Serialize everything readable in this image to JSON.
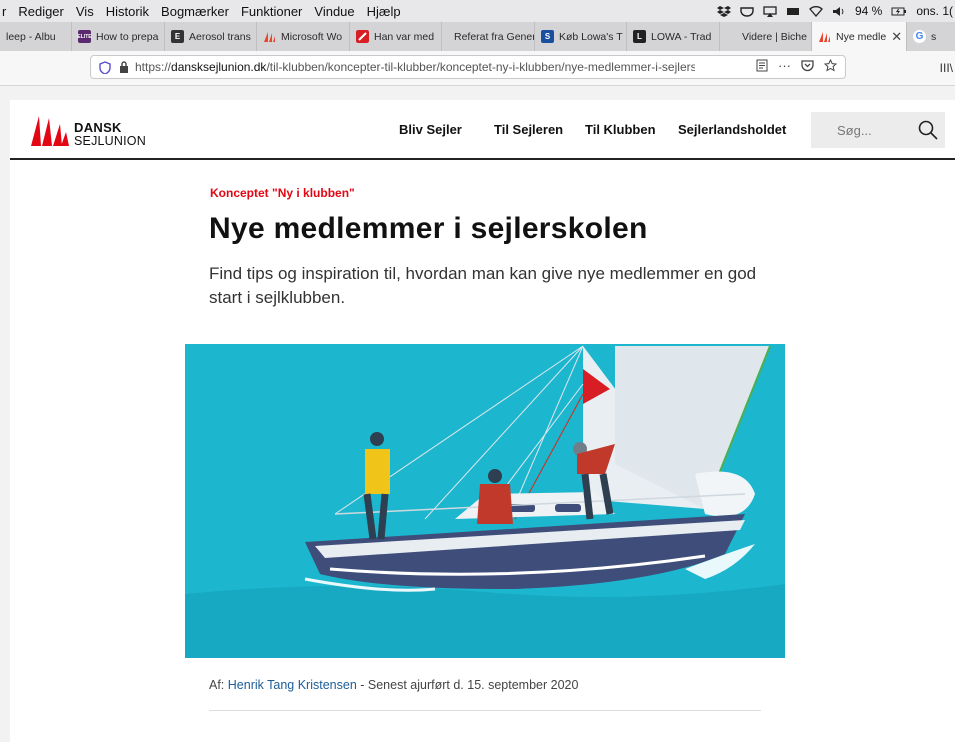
{
  "menubar": {
    "items": [
      "r",
      "Rediger",
      "Vis",
      "Historik",
      "Bogmærker",
      "Funktioner",
      "Vindue",
      "Hjælp"
    ],
    "battery": "94 %",
    "clock": "ons. 1("
  },
  "tabs": [
    {
      "label": "leep - Albu",
      "color": "#6c8fb3",
      "glyph": ""
    },
    {
      "label": "How to prepa",
      "color": "#5a2a6e",
      "glyph": "ELITE"
    },
    {
      "label": "Aerosol trans",
      "color": "#222",
      "glyph": "E"
    },
    {
      "label": "Microsoft Wo",
      "color": "#e8452c",
      "glyph": ""
    },
    {
      "label": "Han var med",
      "color": "#d81e25",
      "glyph": ""
    },
    {
      "label": "Referat fra Gener",
      "color": "#888",
      "glyph": ""
    },
    {
      "label": "Køb Lowa's T",
      "color": "#1a4fa0",
      "glyph": "S"
    },
    {
      "label": "LOWA - Trad",
      "color": "#222",
      "glyph": "L"
    },
    {
      "label": "Videre | Biche",
      "color": "#aaa",
      "glyph": ""
    },
    {
      "label": "Nye medle",
      "color": "#e8452c",
      "glyph": "",
      "active": true
    },
    {
      "label": "s",
      "color": "#4285f4",
      "glyph": "G"
    }
  ],
  "addressbar": {
    "url_prefix": "https://",
    "url_domain": "dansksejlunion.dk",
    "url_path": "/til-klubben/koncepter-til-klubber/konceptet-ny-i-klubben/nye-medlemmer-i-sejlerskolen",
    "more": "···"
  },
  "site": {
    "logo_line1": "DANSK",
    "logo_line2": "SEJLUNION",
    "nav": [
      "Bliv Sejler",
      "Til Sejleren",
      "Til Klubben",
      "Sejlerlandsholdet"
    ],
    "search_placeholder": "Søg..."
  },
  "article": {
    "kicker": "Konceptet \"Ny i klubben\"",
    "title": "Nye medlemmer i sejlerskolen",
    "lede": "Find tips og inspiration til, hvordan man kan give nye medlemmer en god start i sejlklubben.",
    "byline_prefix": "Af: ",
    "author": "Henrik Tang Kristensen",
    "byline_suffix": " - Senest ajurført d. 15. september 2020"
  },
  "colors": {
    "accent_red": "#e30613",
    "link_blue": "#1c5d99",
    "sea": "#1cb7cf"
  }
}
